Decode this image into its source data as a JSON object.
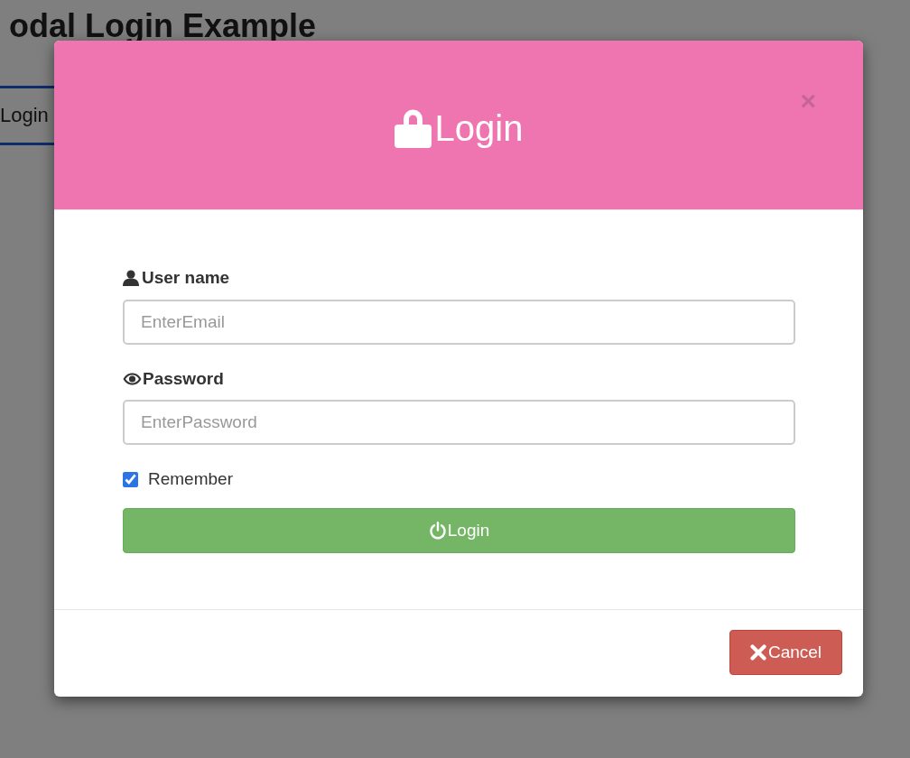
{
  "page": {
    "heading": "odal Login Example",
    "open_button": "Login"
  },
  "modal": {
    "title": "Login",
    "close": "×",
    "fields": [
      {
        "kind": "username",
        "label": "User name",
        "placeholder": "EnterEmail"
      },
      {
        "kind": "password",
        "label": "Password",
        "placeholder": "EnterPassword"
      }
    ],
    "remember": {
      "label": "Remember",
      "checked": true
    },
    "submit": "Login",
    "cancel": "Cancel"
  }
}
